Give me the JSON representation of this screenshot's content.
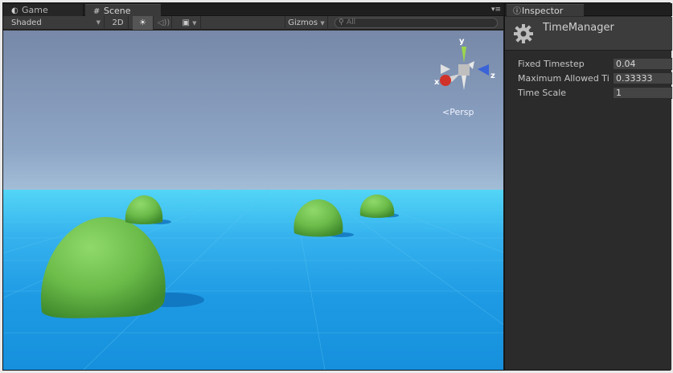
{
  "scene_tabs": [
    {
      "label": "Game",
      "icon": "pacman-icon"
    },
    {
      "label": "Scene",
      "icon": "grid-hash-icon"
    }
  ],
  "toolbar": {
    "shading_mode": "Shaded",
    "mode_2d": "2D",
    "gizmos": "Gizmos",
    "search_placeholder": "All"
  },
  "gizmo": {
    "x_label": "x",
    "y_label": "y",
    "z_label": "z",
    "projection": "Persp"
  },
  "inspector": {
    "tab_label": "Inspector",
    "component_title": "TimeManager",
    "properties": [
      {
        "label": "Fixed Timestep",
        "value": "0.04"
      },
      {
        "label": "Maximum Allowed Ti",
        "value": "0.33333"
      },
      {
        "label": "Time Scale",
        "value": "1"
      }
    ]
  },
  "colors": {
    "editor_bg": "#2a2a2a",
    "sky_top": "#7788a8",
    "ground": "#1e9ae4",
    "sphere": "#74c24e"
  }
}
